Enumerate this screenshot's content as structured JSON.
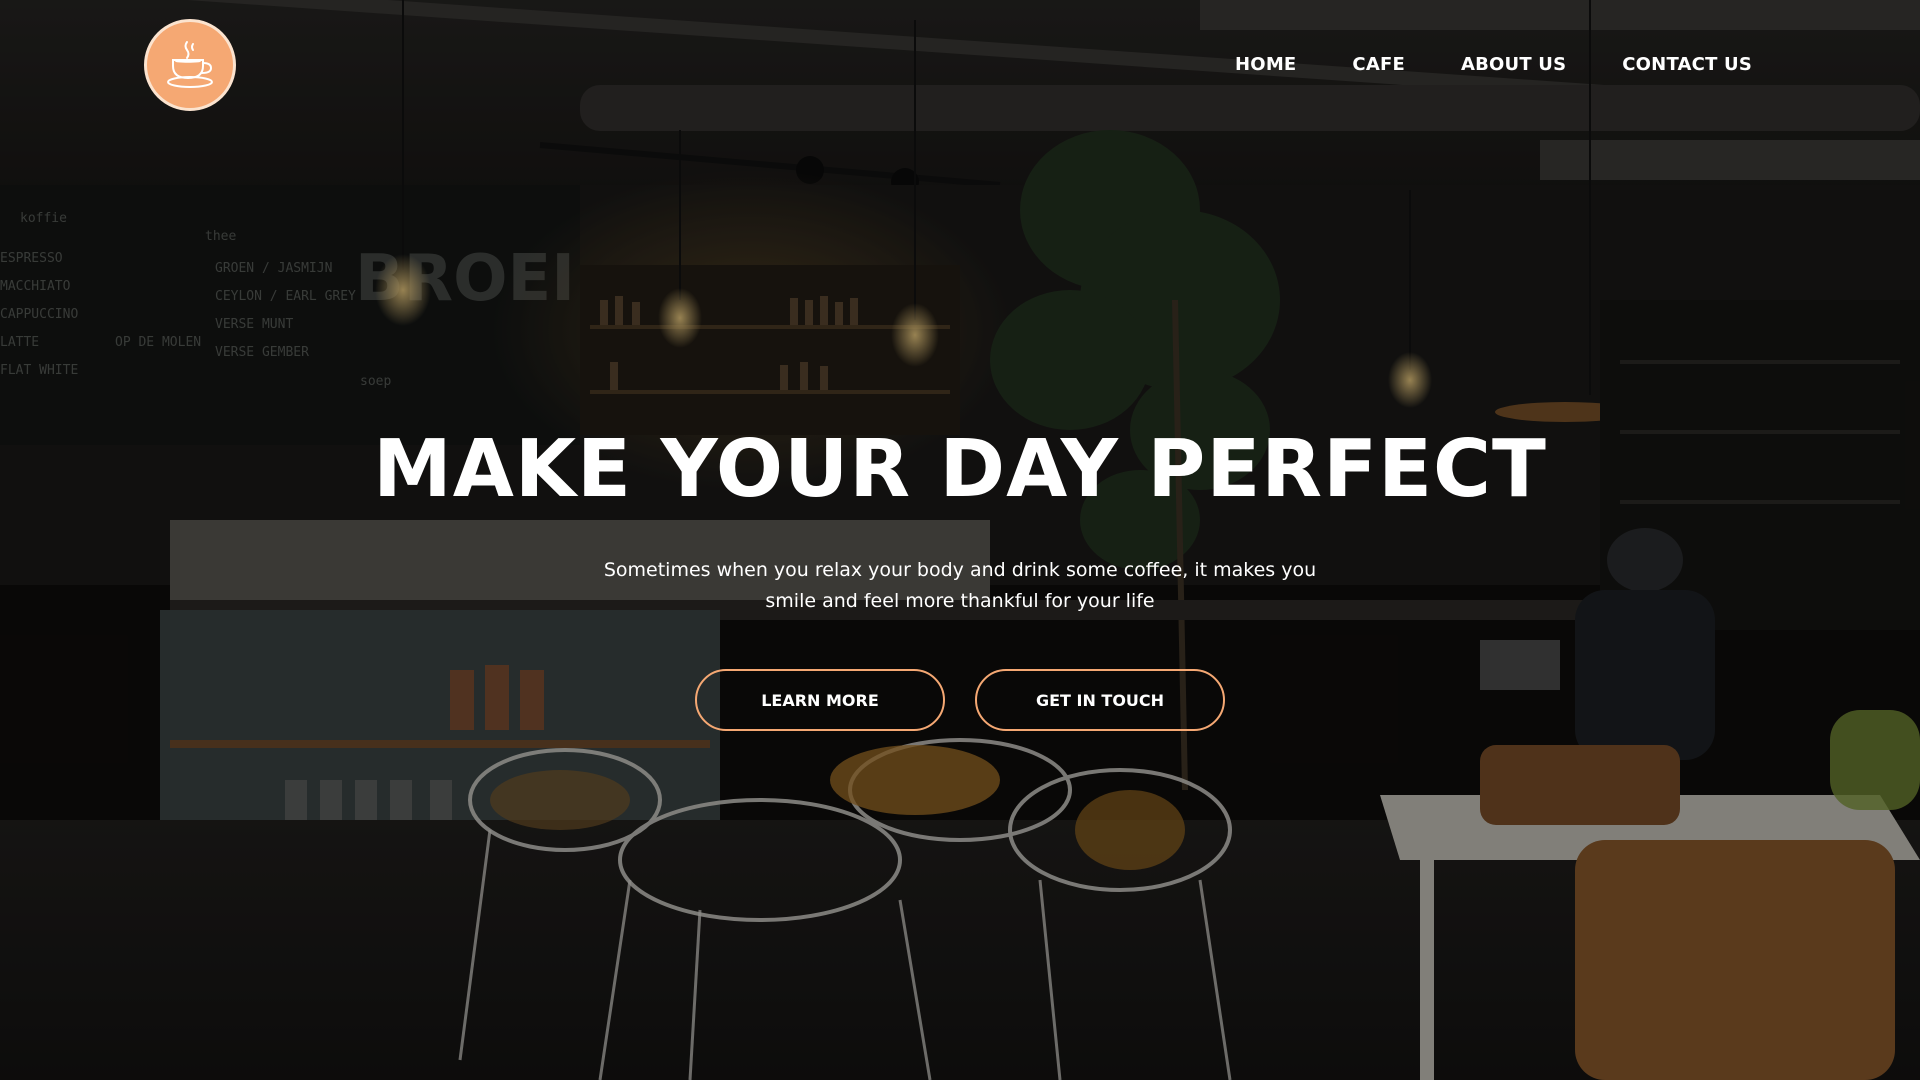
{
  "nav": {
    "logo_icon": "coffee-cup-icon",
    "items": [
      {
        "label": "HOME"
      },
      {
        "label": "CAFE"
      },
      {
        "label": "ABOUT US"
      },
      {
        "label": "CONTACT US"
      }
    ]
  },
  "hero": {
    "title": "MAKE YOUR DAY PERFECT",
    "subtitle": "Sometimes when you relax your body and drink some coffee, it makes you smile and feel more thankful for your life",
    "buttons": {
      "learn_more": "LEARN MORE",
      "get_in_touch": "GET IN TOUCH"
    }
  },
  "colors": {
    "accent": "#f5a873",
    "text": "#ffffff"
  }
}
